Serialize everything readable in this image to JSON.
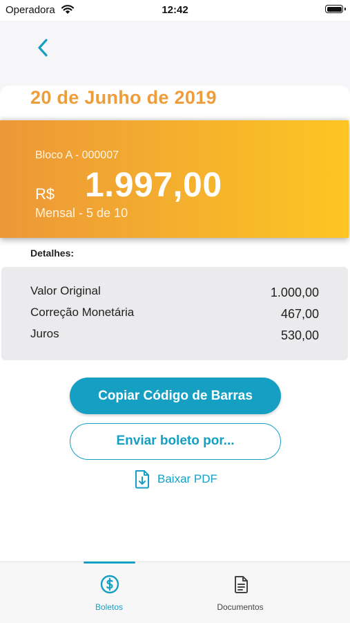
{
  "status_bar": {
    "carrier": "Operadora",
    "time": "12:42"
  },
  "page": {
    "date_title": "20 de Junho de 2019",
    "block_label": "Bloco A - 000007",
    "currency": "R$",
    "amount": "1.997,00",
    "installment": "Mensal - 5 de 10",
    "details_label": "Detalhes:"
  },
  "details": [
    {
      "label": "Valor Original",
      "value": "1.000,00"
    },
    {
      "label": "Correção Monetária",
      "value": "467,00"
    },
    {
      "label": "Juros",
      "value": "530,00"
    }
  ],
  "actions": {
    "copy_barcode": "Copiar Código de Barras",
    "send_boleto": "Enviar boleto por...",
    "download_pdf": "Baixar PDF"
  },
  "tabs": [
    {
      "label": "Boletos",
      "icon": "dollar-circle-icon",
      "active": true
    },
    {
      "label": "Documentos",
      "icon": "document-icon",
      "active": false
    }
  ],
  "colors": {
    "accent": "#149fc3",
    "title_orange": "#ee9d3b",
    "banner_start": "#ec9738",
    "banner_end": "#fdc522",
    "inactive_tab": "#444444"
  }
}
